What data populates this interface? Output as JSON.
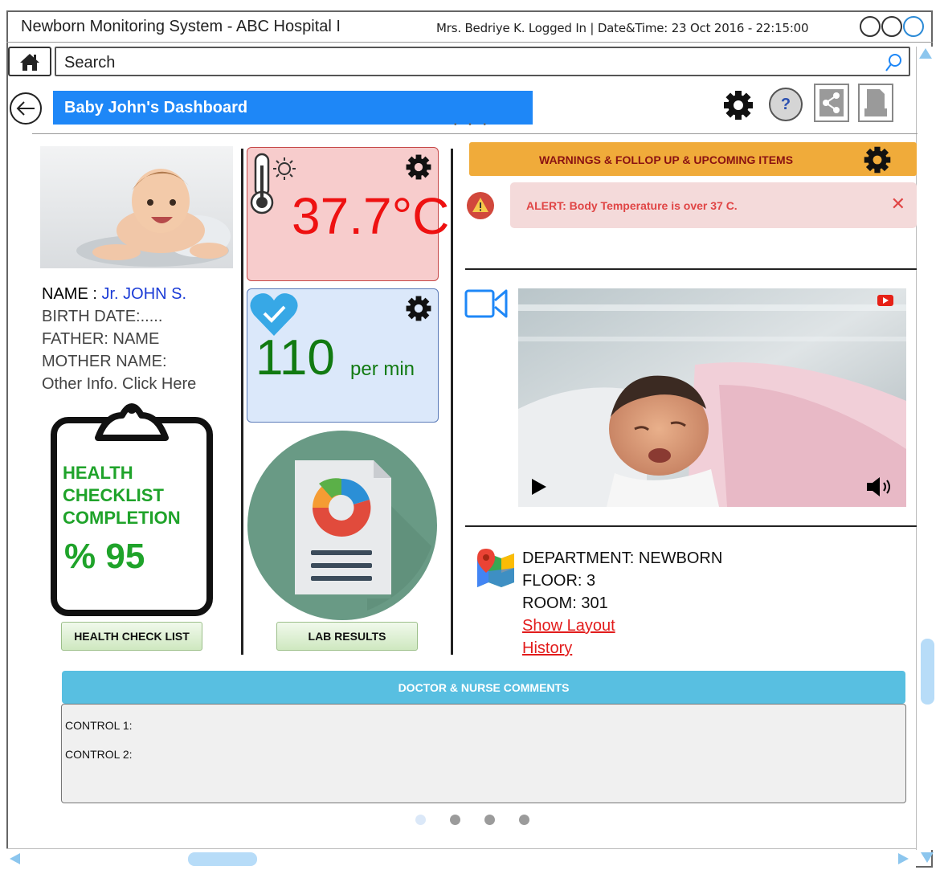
{
  "window": {
    "title": "Newborn Monitoring System - ABC Hospital I",
    "session": "Mrs. Bedriye K. Logged In | Date&Time: 23 Oct 2016 - 22:15:00"
  },
  "search": {
    "value": "Search"
  },
  "header": {
    "title": "Baby John's Dashboard",
    "help_label": "?"
  },
  "profile": {
    "name_label": "NAME :",
    "name_value": "Jr. JOHN S.",
    "birth_date": "BIRTH DATE:.....",
    "father": "FATHER: NAME",
    "mother": "MOTHER NAME:",
    "other_info": "Other Info. Click Here"
  },
  "health_checklist": {
    "text_line1": "HEALTH",
    "text_line2": "CHECKLIST",
    "text_line3": "COMPLETION",
    "percent_text": "% 95",
    "percent": 95,
    "button_label": "HEALTH CHECK LIST"
  },
  "vitals": {
    "temperature": "37.7°C",
    "heart_rate": "110",
    "heart_rate_unit": "per min"
  },
  "lab": {
    "button_label": "LAB RESULTS"
  },
  "warnings": {
    "title": "WARNINGS & FOLLOP UP & UPCOMING ITEMS",
    "alert_text": "ALERT: Body Temperature is over 37 C.",
    "close_label": "✕"
  },
  "location": {
    "department": "DEPARTMENT: NEWBORN",
    "floor": "FLOOR: 3",
    "room": "ROOM: 301",
    "show_layout": "Show Layout",
    "history": "History"
  },
  "comments": {
    "title": "DOCTOR & NURSE COMMENTS",
    "control1": "CONTROL 1:",
    "control2": "CONTROL 2:"
  },
  "pager": {
    "count": 4,
    "active_index": 0
  },
  "colors": {
    "accent": "#1e87f7",
    "warning": "#f0ab3a",
    "alert": "#e04545",
    "success": "#1fa32a",
    "comments_header": "#58bfe1"
  },
  "icons": [
    "home-icon",
    "search-icon",
    "back-arrow-icon",
    "gear-icon",
    "share-icon",
    "document-icon",
    "thermometer-icon",
    "heart-check-icon",
    "lab-report-icon",
    "clipboard-icon",
    "warning-triangle-icon",
    "video-camera-icon",
    "map-pin-icon",
    "play-icon",
    "volume-icon",
    "youtube-icon"
  ]
}
